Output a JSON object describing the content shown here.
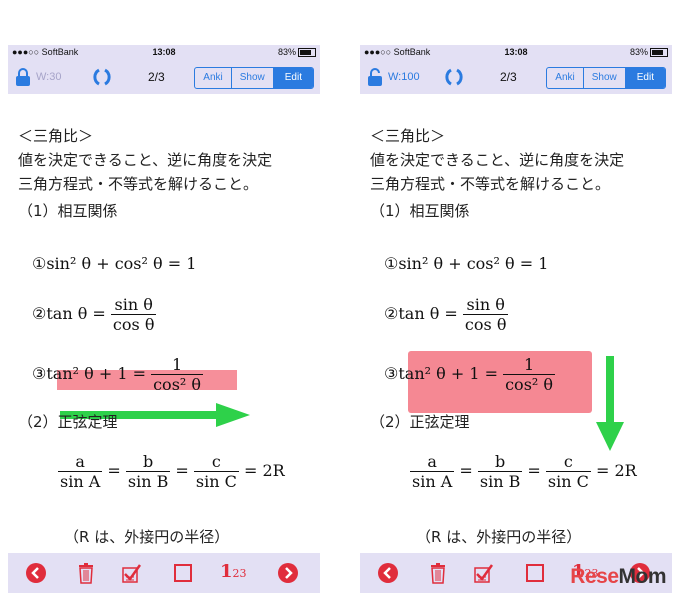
{
  "status": {
    "carrier": "●●●○○ SoftBank",
    "time": "13:08",
    "battery": "83%"
  },
  "left": {
    "wcount": "W:30",
    "page": "2/3"
  },
  "right": {
    "wcount": "W:100",
    "page": "2/3"
  },
  "segments": [
    "Anki",
    "Show",
    "Edit"
  ],
  "text": {
    "heading": "＜三角比＞",
    "line1": "値を決定できること、逆に角度を決定",
    "line2": "三角方程式・不等式を解けること。",
    "section1": "（1）相互関係",
    "section2": "（2）正弦定理",
    "note": "（R は、外接円の半径）"
  },
  "math": {
    "f1_mark": "①",
    "f1": "sin² θ + cos² θ = 1",
    "f2_mark": "②",
    "f2_lhs": "tan θ =",
    "f2_num": "sin θ",
    "f2_den": "cos θ",
    "f3_mark": "③",
    "f3_lhs": "tan² θ + 1 =",
    "f3_num": "1",
    "f3_den": "cos² θ",
    "law_a": "a",
    "law_sinA": "sin A",
    "law_b": "b",
    "law_sinB": "sin B",
    "law_c": "c",
    "law_sinC": "sin C",
    "law_rhs": "= 2R"
  },
  "bottom": {
    "counter": "1",
    "counter_sub": "23"
  },
  "colors": {
    "bar": "#e3e0f4",
    "accent": "#2b7be0",
    "highlight": "#f36a78",
    "arrow": "#2ed14a",
    "icon_red": "#e02d3c"
  },
  "logo": {
    "part1": "Rese",
    "part2": "Mom"
  }
}
